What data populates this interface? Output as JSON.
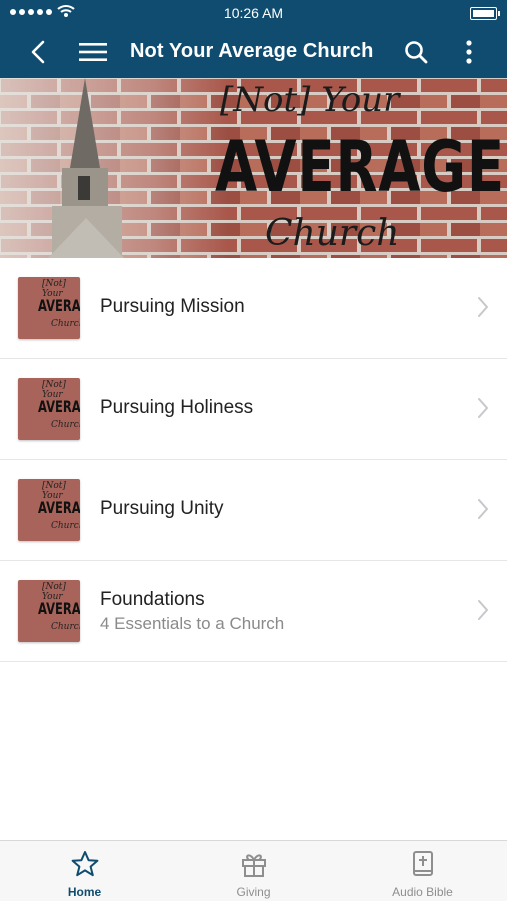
{
  "status_bar": {
    "time": "10:26 AM"
  },
  "nav": {
    "title": "Not Your Average Church"
  },
  "banner": {
    "tag": "[Not] Your",
    "headline": "AVERAGE",
    "subtitle": "Church"
  },
  "thumbnail": {
    "line1": "[Not] Your",
    "line2": "AVERAGE",
    "line3": "Church"
  },
  "items": [
    {
      "title": "Pursuing Mission",
      "subtitle": ""
    },
    {
      "title": "Pursuing Holiness",
      "subtitle": ""
    },
    {
      "title": "Pursuing Unity",
      "subtitle": ""
    },
    {
      "title": "Foundations",
      "subtitle": "4 Essentials to a Church"
    }
  ],
  "tabs": [
    {
      "label": "Home",
      "icon": "star-icon",
      "active": true
    },
    {
      "label": "Giving",
      "icon": "gift-icon",
      "active": false
    },
    {
      "label": "Audio Bible",
      "icon": "bible-icon",
      "active": false
    }
  ],
  "colors": {
    "primary": "#0f4c6f",
    "brick": "#a8645a",
    "inactive": "#8e8e8e"
  }
}
